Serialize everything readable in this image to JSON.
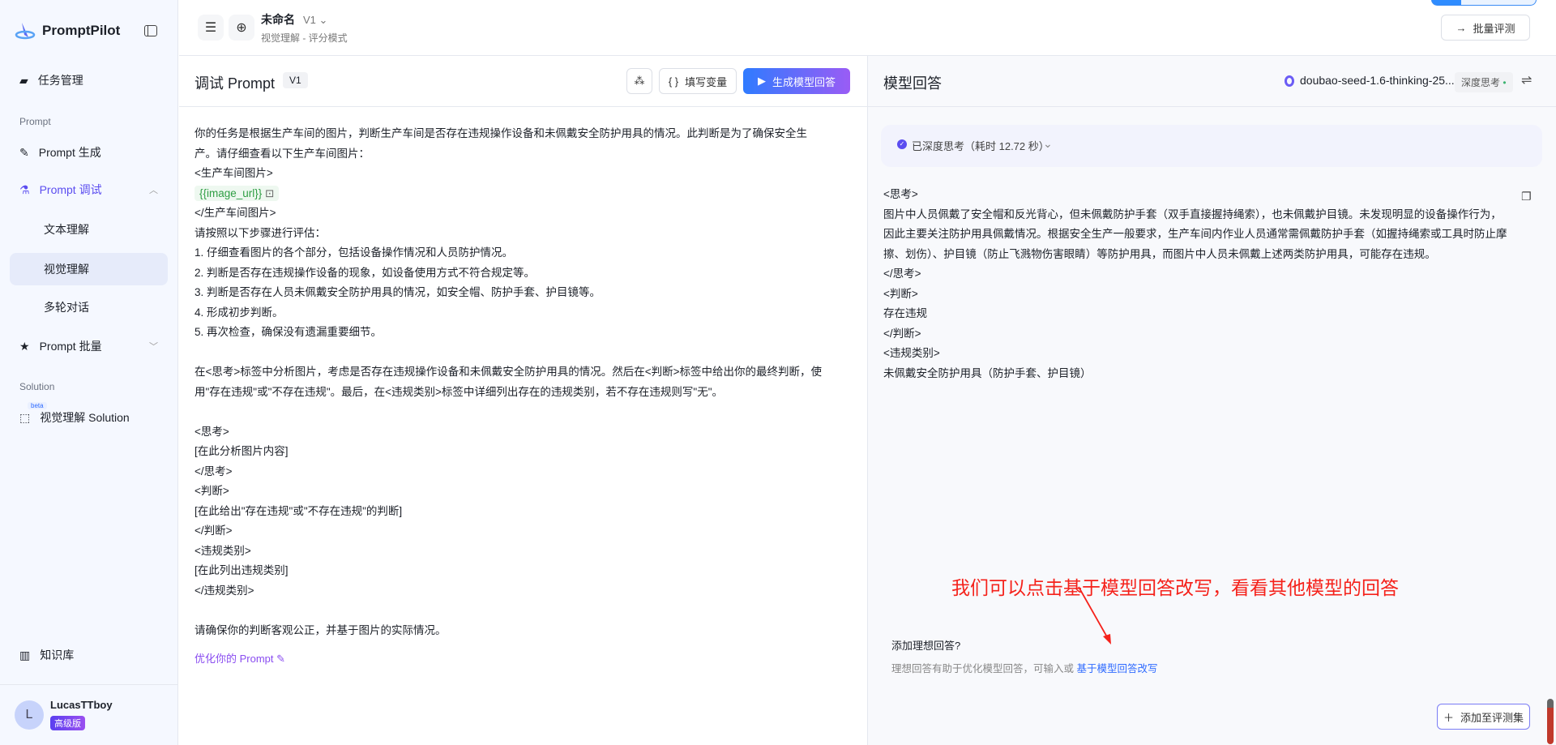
{
  "sidebar": {
    "brand": "PromptPilot",
    "items": [
      {
        "label": "任务管理"
      },
      {
        "label": "Prompt 生成"
      },
      {
        "label": "Prompt 调试"
      },
      {
        "label": "文本理解"
      },
      {
        "label": "视觉理解"
      },
      {
        "label": "多轮对话"
      },
      {
        "label": "Prompt 批量"
      },
      {
        "label": "视觉理解 Solution",
        "badge": "beta"
      },
      {
        "label": "知识库"
      }
    ],
    "sections": [
      "Prompt",
      "Solution"
    ],
    "user": {
      "initial": "L",
      "name": "LucasTTboy",
      "plan": "高级版"
    }
  },
  "header": {
    "title": "未命名",
    "version": "V1",
    "subtitle": "视觉理解 - 评分模式",
    "batch_eval": "批量评测"
  },
  "prompt_panel": {
    "title": "调试 Prompt",
    "version": "V1",
    "fill_vars": "填写变量",
    "generate": "生成模型回答",
    "optimize": "优化你的 Prompt",
    "lines_before": "你的任务是根据生产车间的图片，判断生产车间是否存在违规操作设备和未佩戴安全防护用具的情况。此判断是为了确保安全生\n产。请仔细查看以下生产车间图片：\n<生产车间图片>",
    "variable": "{{image_url}}",
    "lines_after": "</生产车间图片>\n请按照以下步骤进行评估：\n1. 仔细查看图片的各个部分，包括设备操作情况和人员防护情况。\n2. 判断是否存在违规操作设备的现象，如设备使用方式不符合规定等。\n3. 判断是否存在人员未佩戴安全防护用具的情况，如安全帽、防护手套、护目镜等。\n4. 形成初步判断。\n5. 再次检查，确保没有遗漏重要细节。\n\n在<思考>标签中分析图片，考虑是否存在违规操作设备和未佩戴安全防护用具的情况。然后在<判断>标签中给出你的最终判断，使\n用\"存在违规\"或\"不存在违规\"。最后，在<违规类别>标签中详细列出存在的违规类别，若不存在违规则写\"无\"。\n\n<思考>\n[在此分析图片内容]\n</思考>\n<判断>\n[在此给出\"存在违规\"或\"不存在违规\"的判断]\n</判断>\n<违规类别>\n[在此列出违规类别]\n</违规类别>\n\n请确保你的判断客观公正，并基于图片的实际情况。"
  },
  "answer_panel": {
    "title": "模型回答",
    "model": "doubao-seed-1.6-thinking-25...",
    "mode": "深度思考",
    "thinking_status": "已深度思考（耗时 12.72 秒）",
    "response": "<思考>\n图片中人员佩戴了安全帽和反光背心，但未佩戴防护手套（双手直接握持绳索），也未佩戴护目镜。未发现明显的设备操作行为，\n因此主要关注防护用具佩戴情况。根据安全生产一般要求，生产车间内作业人员通常需佩戴防护手套（如握持绳索或工具时防止摩\n擦、划伤）、护目镜（防止飞溅物伤害眼睛）等防护用具，而图片中人员未佩戴上述两类防护用具，可能存在违规。\n</思考>\n<判断>\n存在违规\n</判断>\n<违规类别>\n未佩戴安全防护用具（防护手套、护目镜）",
    "ideal_title": "添加理想回答?",
    "ideal_desc": "理想回答有助于优化模型回答，可输入或",
    "ideal_link": "基于模型回答改写",
    "add_to_set": "添加至评测集"
  },
  "annotation": {
    "text": "我们可以点击基于模型回答改写，看看其他模型的回答",
    "color": "#f5221b"
  }
}
